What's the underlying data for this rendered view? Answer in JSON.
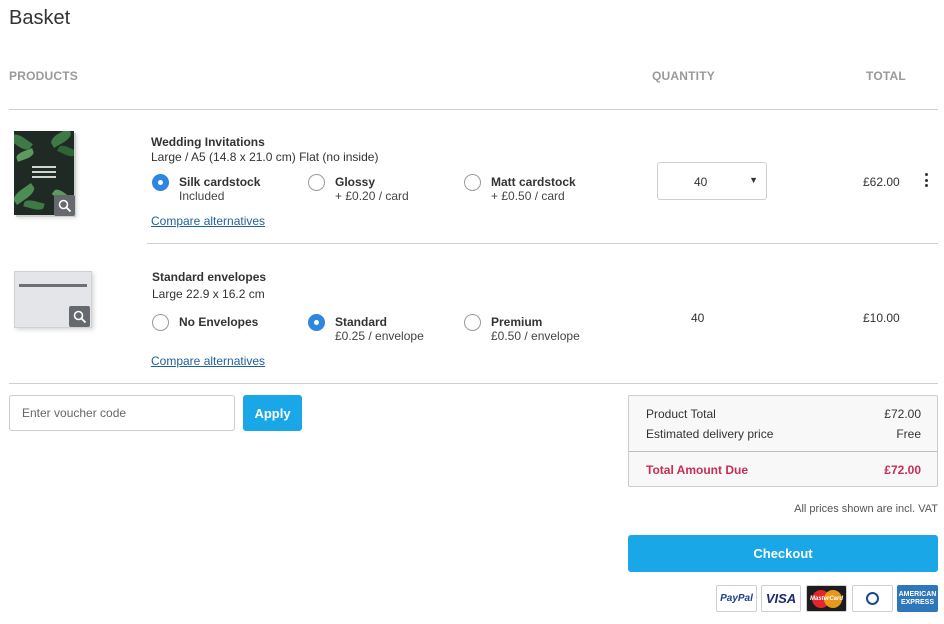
{
  "page": {
    "title": "Basket"
  },
  "columns": {
    "products": "PRODUCTS",
    "quantity": "QUANTITY",
    "total": "TOTAL"
  },
  "items": [
    {
      "name": "Wedding Invitations",
      "spec": "Large / A5 (14.8 x 21.0 cm) Flat (no inside)",
      "options": [
        {
          "label": "Silk cardstock",
          "sub": "Included",
          "selected": true
        },
        {
          "label": "Glossy",
          "sub": "+ £0.20 / card",
          "selected": false
        },
        {
          "label": "Matt cardstock",
          "sub": "+ £0.50 / card",
          "selected": false
        }
      ],
      "compare": "Compare alternatives",
      "quantity": "40",
      "price": "£62.00"
    },
    {
      "name": "Standard envelopes",
      "spec": "Large 22.9 x 16.2 cm",
      "options": [
        {
          "label": "No Envelopes",
          "sub": "",
          "selected": false
        },
        {
          "label": "Standard",
          "sub": "£0.25 / envelope",
          "selected": true
        },
        {
          "label": "Premium",
          "sub": "£0.50 / envelope",
          "selected": false
        }
      ],
      "compare": "Compare alternatives",
      "quantity": "40",
      "price": "£10.00"
    }
  ],
  "voucher": {
    "placeholder": "Enter voucher code",
    "apply_label": "Apply"
  },
  "summary": {
    "product_total_label": "Product Total",
    "product_total_value": "£72.00",
    "delivery_label": "Estimated delivery price",
    "delivery_value": "Free",
    "due_label": "Total Amount Due",
    "due_value": "£72.00"
  },
  "vat_note": "All prices shown are incl. VAT",
  "checkout_label": "Checkout",
  "payment_methods": [
    {
      "name": "PayPal",
      "icon": "paypal-logo"
    },
    {
      "name": "VISA",
      "icon": "visa-logo"
    },
    {
      "name": "MasterCard",
      "icon": "mastercard-logo"
    },
    {
      "name": "Diners Club International",
      "icon": "diners-club-logo"
    },
    {
      "name": "AMERICAN EXPRESS",
      "icon": "amex-logo"
    }
  ],
  "colors": {
    "accent": "#19a7e8",
    "radio_selected": "#2e86de",
    "due": "#c52f55",
    "link": "#1f5f9f"
  }
}
